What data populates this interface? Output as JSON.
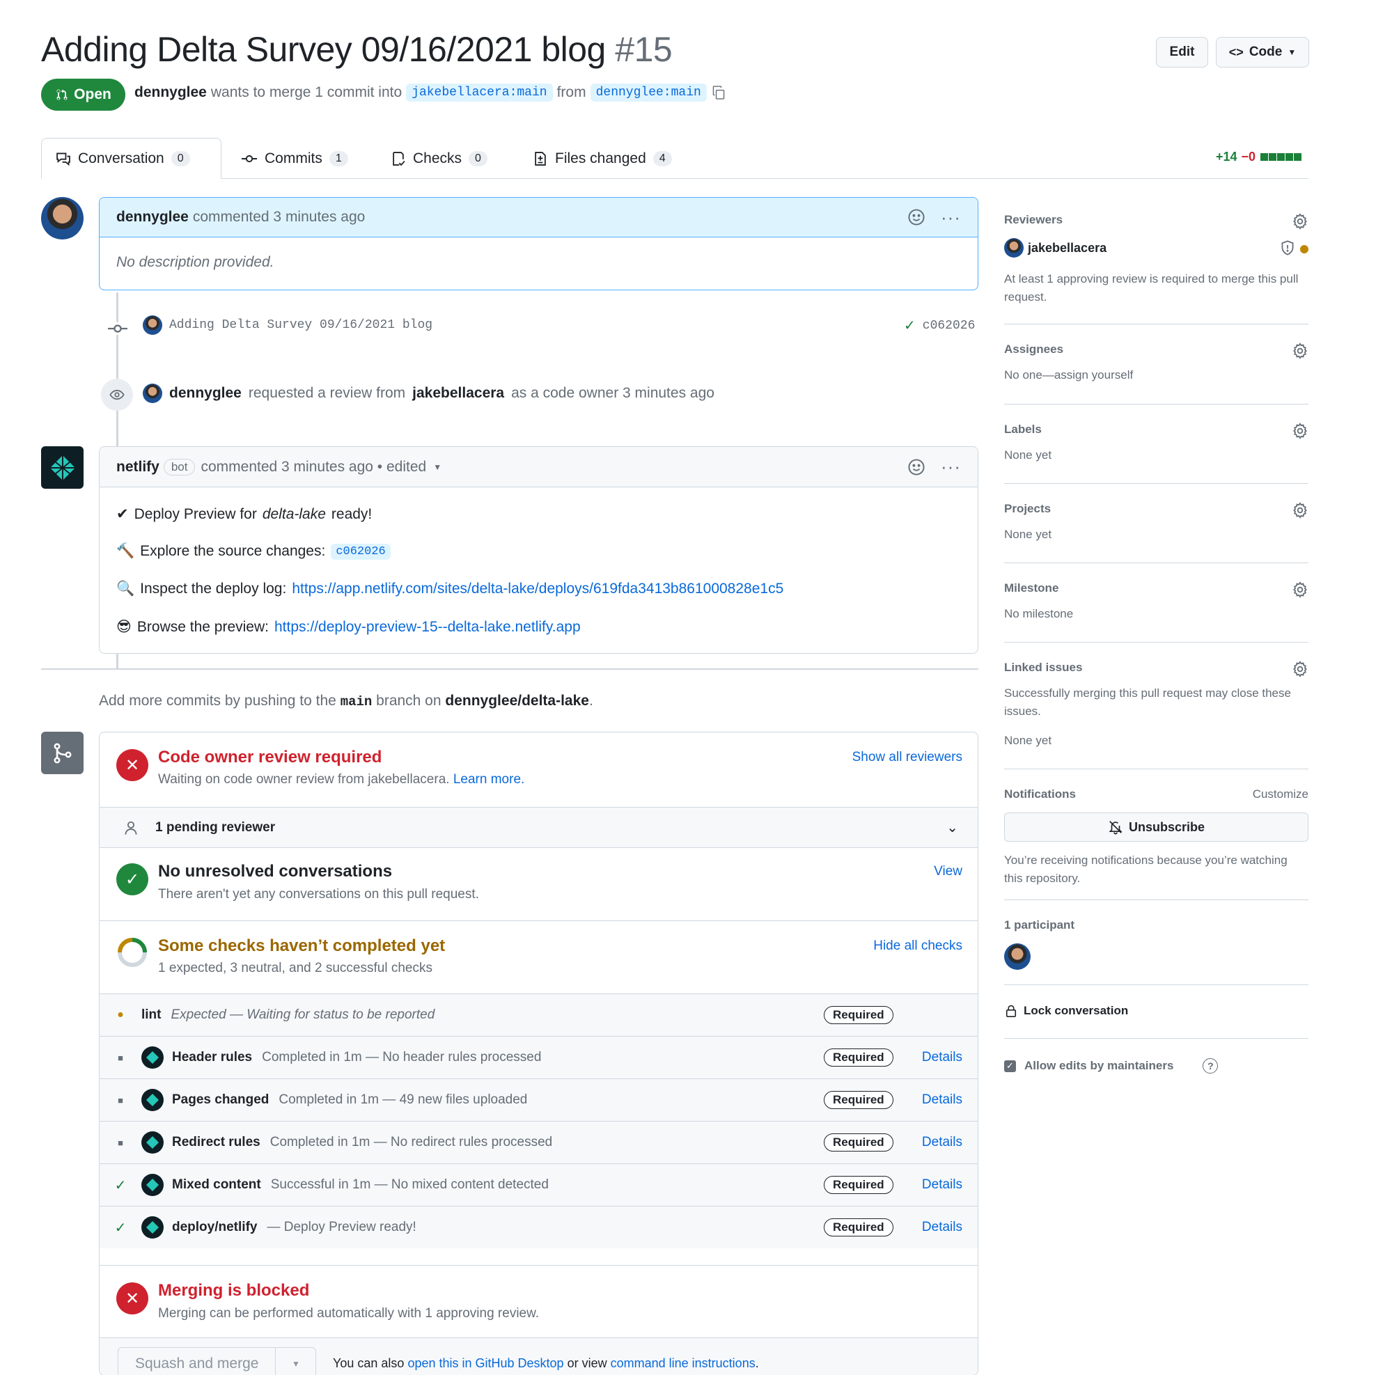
{
  "pr": {
    "title": "Adding Delta Survey 09/16/2021 blog",
    "number": "#15",
    "state": "Open",
    "author": "dennyglee",
    "merge_text": "wants to merge 1 commit into",
    "base_branch": "jakebellacera:main",
    "from_text": "from",
    "head_branch": "dennyglee:main"
  },
  "header_buttons": {
    "edit": "Edit",
    "code": "Code"
  },
  "tabs": [
    {
      "label": "Conversation",
      "count": "0"
    },
    {
      "label": "Commits",
      "count": "1"
    },
    {
      "label": "Checks",
      "count": "0"
    },
    {
      "label": "Files changed",
      "count": "4"
    }
  ],
  "diffstat": {
    "additions": "+14",
    "deletions": "−0"
  },
  "comment1": {
    "author": "dennyglee",
    "action": "commented 3 minutes ago",
    "body": "No description provided."
  },
  "commit_event": {
    "message": "Adding Delta Survey 09/16/2021 blog",
    "sha": "c062026"
  },
  "review_event": {
    "actor": "dennyglee",
    "text1": "requested a review from",
    "reviewer": "jakebellacera",
    "text2": "as a code owner 3 minutes ago"
  },
  "comment2": {
    "author": "netlify",
    "bot_label": "bot",
    "action": "commented 3 minutes ago • edited",
    "line1_prefix": "Deploy Preview for",
    "line1_site": "delta-lake",
    "line1_suffix": "ready!",
    "line2_prefix": "Explore the source changes:",
    "line2_sha": "c062026",
    "line3_prefix": "Inspect the deploy log:",
    "line3_url": "https://app.netlify.com/sites/delta-lake/deploys/619fda3413b861000828e1c5",
    "line4_prefix": "Browse the preview:",
    "line4_url": "https://deploy-preview-15--delta-lake.netlify.app"
  },
  "push_hint": {
    "prefix": "Add more commits by pushing to the",
    "branch": "main",
    "middle": "branch on",
    "repo": "dennyglee/delta-lake",
    "suffix": "."
  },
  "merge_box": {
    "code_owner": {
      "title": "Code owner review required",
      "subtitle": "Waiting on code owner review from jakebellacera.",
      "learn_more": "Learn more.",
      "action": "Show all reviewers"
    },
    "pending_reviewer": "1 pending reviewer",
    "conversations": {
      "title": "No unresolved conversations",
      "subtitle": "There aren't yet any conversations on this pull request.",
      "action": "View"
    },
    "checks": {
      "title": "Some checks haven’t completed yet",
      "subtitle": "1 expected, 3 neutral, and 2 successful checks",
      "action": "Hide all checks"
    },
    "check_rows": [
      {
        "name": "lint",
        "desc": "Expected — Waiting for status to be reported",
        "status": "pending",
        "required": "Required",
        "details": ""
      },
      {
        "name": "Header rules",
        "desc": "Completed in 1m — No header rules processed",
        "status": "neutral",
        "required": "Required",
        "details": "Details"
      },
      {
        "name": "Pages changed",
        "desc": "Completed in 1m — 49 new files uploaded",
        "status": "neutral",
        "required": "Required",
        "details": "Details"
      },
      {
        "name": "Redirect rules",
        "desc": "Completed in 1m — No redirect rules processed",
        "status": "neutral",
        "required": "Required",
        "details": "Details"
      },
      {
        "name": "Mixed content",
        "desc": "Successful in 1m — No mixed content detected",
        "status": "success",
        "required": "Required",
        "details": "Details"
      },
      {
        "name": "deploy/netlify",
        "desc": "— Deploy Preview ready!",
        "status": "success",
        "required": "Required",
        "details": "Details"
      }
    ],
    "blocked": {
      "title": "Merging is blocked",
      "subtitle": "Merging can be performed automatically with 1 approving review."
    },
    "merge_button": "Squash and merge",
    "footer_prefix": "You can also",
    "footer_link1": "open this in GitHub Desktop",
    "footer_middle": "or view",
    "footer_link2": "command line instructions",
    "footer_suffix": "."
  },
  "sidebar": {
    "reviewers": {
      "title": "Reviewers",
      "name": "jakebellacera",
      "note": "At least 1 approving review is required to merge this pull request."
    },
    "assignees": {
      "title": "Assignees",
      "value": "No one—assign yourself"
    },
    "labels": {
      "title": "Labels",
      "value": "None yet"
    },
    "projects": {
      "title": "Projects",
      "value": "None yet"
    },
    "milestone": {
      "title": "Milestone",
      "value": "No milestone"
    },
    "linked_issues": {
      "title": "Linked issues",
      "note": "Successfully merging this pull request may close these issues.",
      "value": "None yet"
    },
    "notifications": {
      "title": "Notifications",
      "customize": "Customize",
      "button": "Unsubscribe",
      "note": "You’re receiving notifications because you’re watching this repository."
    },
    "participants": {
      "title": "1 participant"
    },
    "lock": "Lock conversation",
    "allow_edits": "Allow edits by maintainers"
  },
  "colors": {
    "open_green": "#1f883d",
    "danger_red": "#cf222e",
    "attention_yellow": "#9a6700",
    "link_blue": "#0969da"
  }
}
